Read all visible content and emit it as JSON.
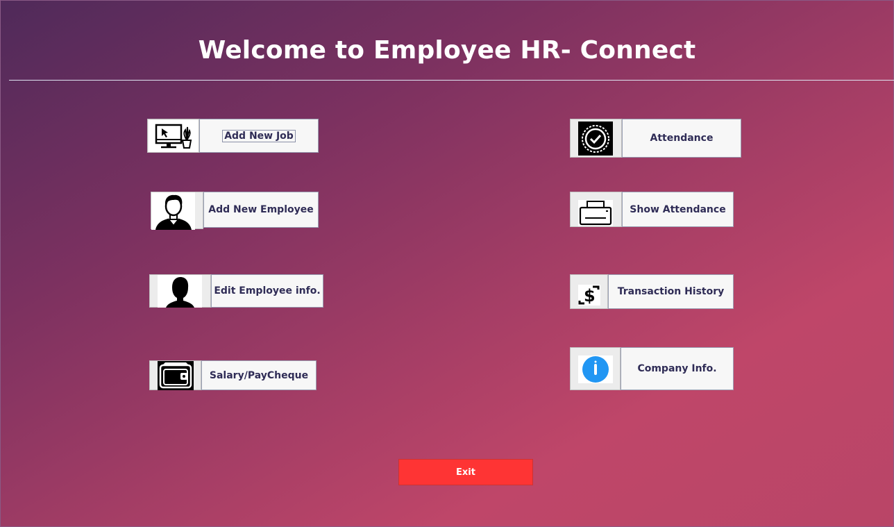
{
  "title": "Welcome to Employee HR- Connect",
  "colors": {
    "button_text": "#2f2c56",
    "exit_bg": "#fe3434",
    "info_blue": "#2196f3"
  },
  "left_buttons": [
    {
      "label": "Add New Job",
      "icon": "desktop-plant-icon"
    },
    {
      "label": "Add New Employee",
      "icon": "employee-avatar-icon"
    },
    {
      "label": "Edit Employee info.",
      "icon": "person-silhouette-icon"
    },
    {
      "label": "Salary/PayCheque",
      "icon": "wallet-icon"
    }
  ],
  "right_buttons": [
    {
      "label": "Attendance",
      "icon": "verified-badge-icon"
    },
    {
      "label": "Show Attendance",
      "icon": "printer-icon"
    },
    {
      "label": "Transaction History",
      "icon": "dollar-transfer-icon"
    },
    {
      "label": "Company Info.",
      "icon": "info-circle-icon"
    }
  ],
  "exit_label": "Exit"
}
